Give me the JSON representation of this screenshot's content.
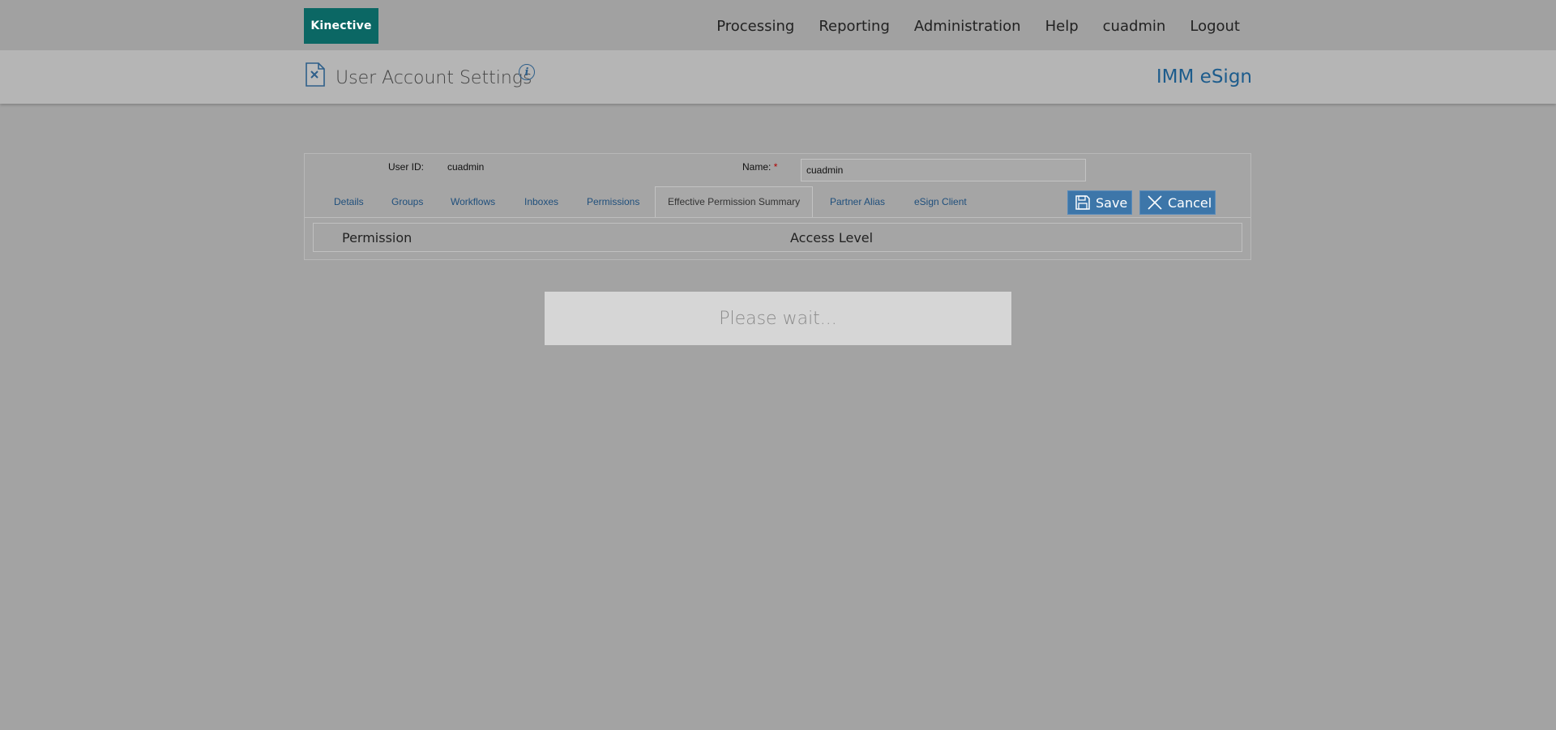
{
  "header": {
    "logo": "Kinective",
    "nav": [
      "Processing",
      "Reporting",
      "Administration",
      "Help",
      "cuadmin",
      "Logout"
    ]
  },
  "titlebar": {
    "title": "User Account Settings",
    "info": "i",
    "brand": "IMM eSign"
  },
  "form": {
    "user_id_label": "User ID:",
    "user_id_value": "cuadmin",
    "name_label": "Name:",
    "name_required": "*",
    "name_value": "cuadmin"
  },
  "tabs": [
    "Details",
    "Groups",
    "Workflows",
    "Inboxes",
    "Permissions",
    "Effective Permission Summary",
    "Partner Alias",
    "eSign Client"
  ],
  "active_tab": "Effective Permission Summary",
  "buttons": {
    "save": "Save",
    "cancel": "Cancel"
  },
  "table": {
    "columns": [
      "Permission",
      "Access Level"
    ]
  },
  "overlay": {
    "message": "Please wait..."
  },
  "colors": {
    "logo_bg": "#0b6764",
    "button_bg": "#3d76a9",
    "brand": "#1d5c8c",
    "link": "#1f4f7c"
  }
}
